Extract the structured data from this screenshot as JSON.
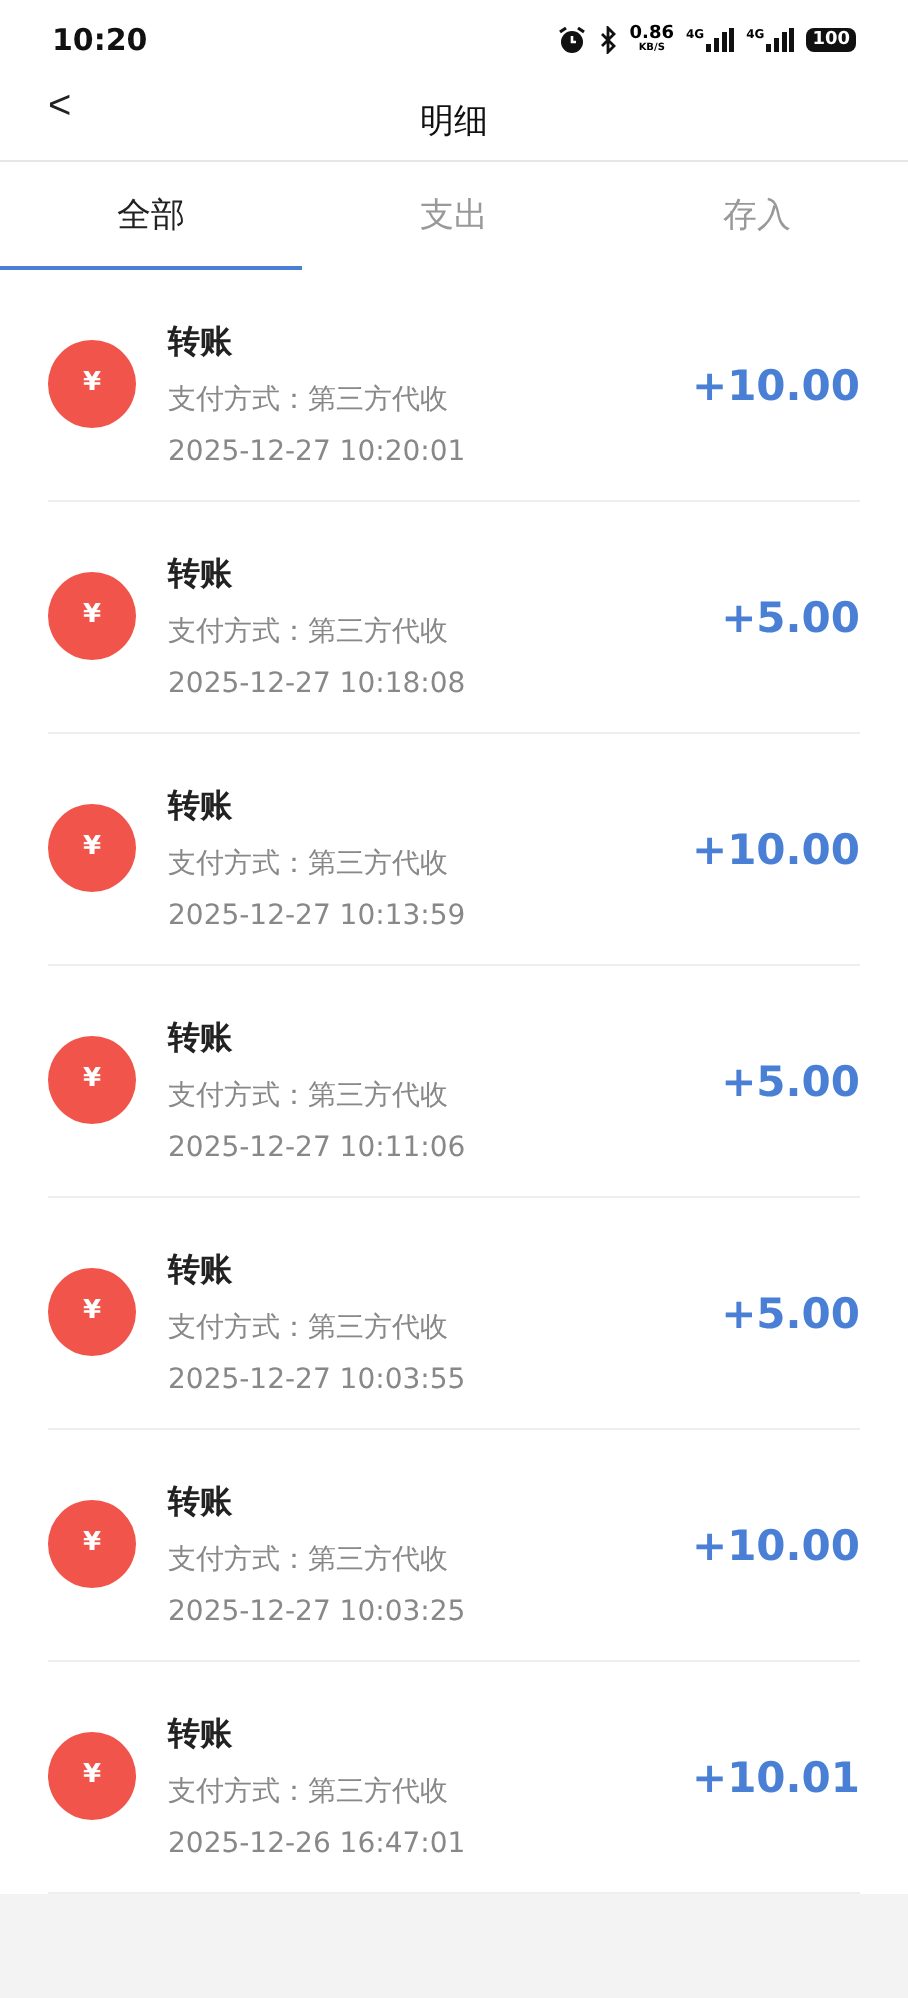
{
  "status_bar": {
    "time": "10:20",
    "speed": "0.86",
    "speed_unit": "KB/S",
    "networks": [
      "4G",
      "4G"
    ],
    "battery": "100"
  },
  "header": {
    "back": "<",
    "title": "明细"
  },
  "tabs": [
    {
      "label": "全部",
      "selected": true
    },
    {
      "label": "支出",
      "selected": false
    },
    {
      "label": "存入",
      "selected": false
    }
  ],
  "transactions": [
    {
      "icon": "¥",
      "title": "转账",
      "method": "支付方式：第三方代收",
      "time": "2025-12-27 10:20:01",
      "amount": "+10.00"
    },
    {
      "icon": "¥",
      "title": "转账",
      "method": "支付方式：第三方代收",
      "time": "2025-12-27 10:18:08",
      "amount": "+5.00"
    },
    {
      "icon": "¥",
      "title": "转账",
      "method": "支付方式：第三方代收",
      "time": "2025-12-27 10:13:59",
      "amount": "+10.00"
    },
    {
      "icon": "¥",
      "title": "转账",
      "method": "支付方式：第三方代收",
      "time": "2025-12-27 10:11:06",
      "amount": "+5.00"
    },
    {
      "icon": "¥",
      "title": "转账",
      "method": "支付方式：第三方代收",
      "time": "2025-12-27 10:03:55",
      "amount": "+5.00"
    },
    {
      "icon": "¥",
      "title": "转账",
      "method": "支付方式：第三方代收",
      "time": "2025-12-27 10:03:25",
      "amount": "+10.00"
    },
    {
      "icon": "¥",
      "title": "转账",
      "method": "支付方式：第三方代收",
      "time": "2025-12-26 16:47:01",
      "amount": "+10.01"
    }
  ]
}
